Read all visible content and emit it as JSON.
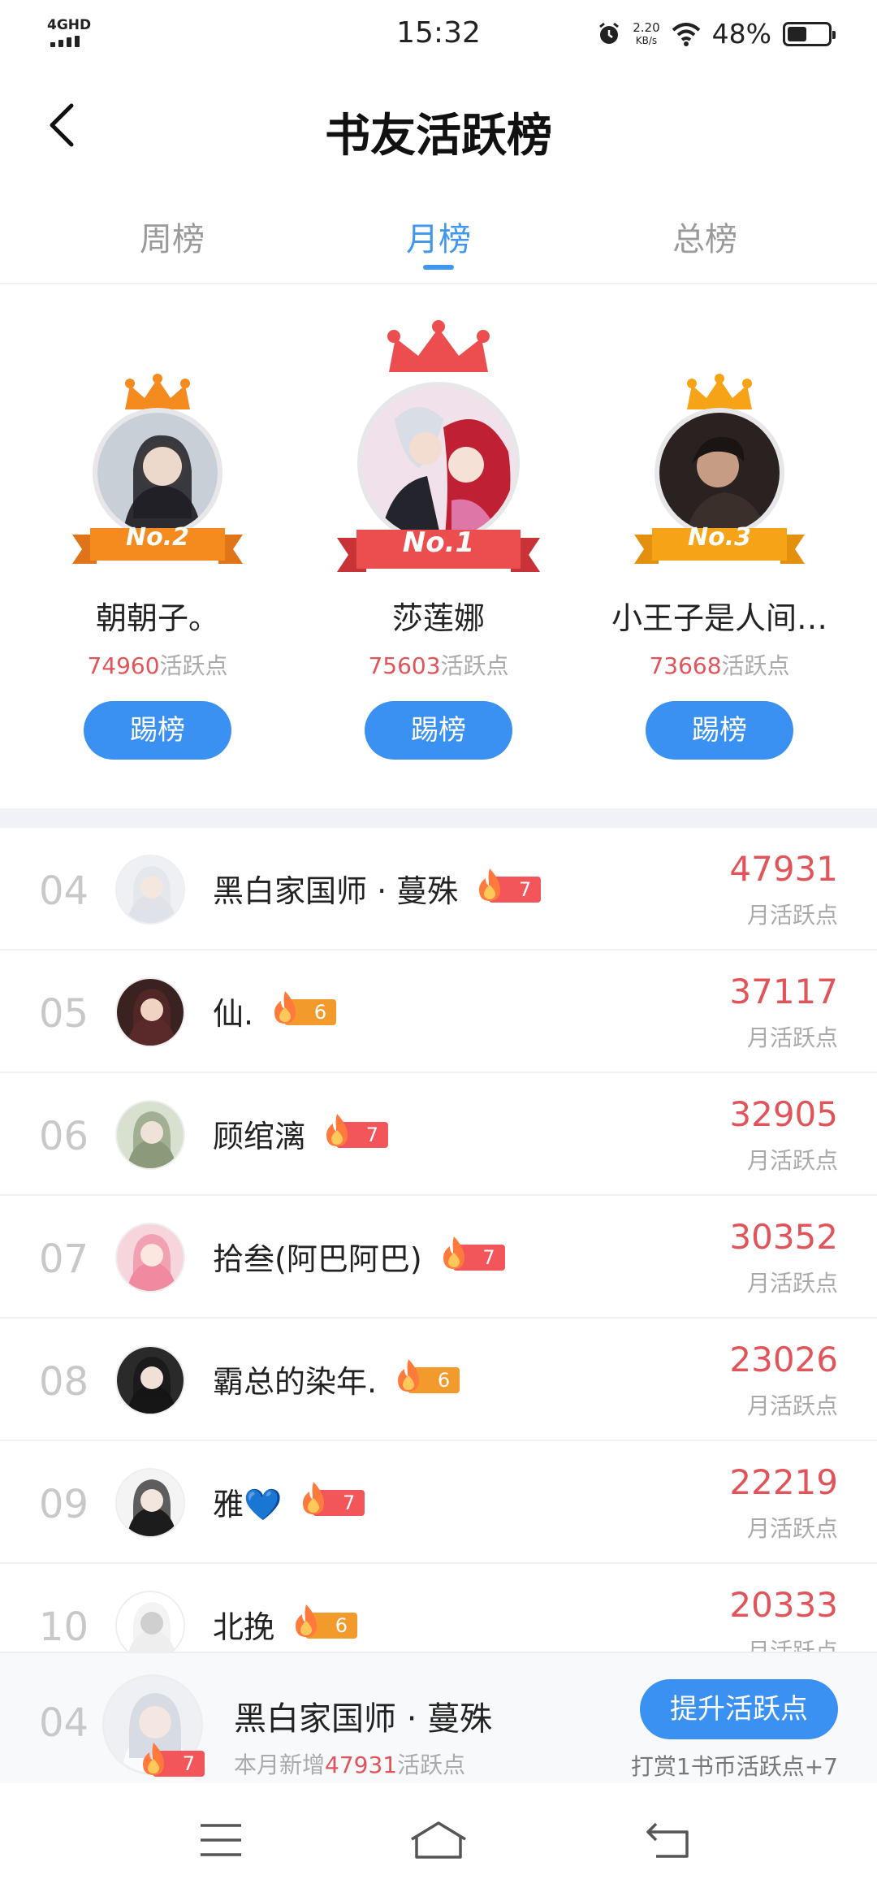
{
  "status_bar": {
    "network": "4GHD",
    "time": "15:32",
    "speed_value": "2.20",
    "speed_unit": "KB/s",
    "battery_text": "48%",
    "battery_level": 0.48
  },
  "nav": {
    "title": "书友活跃榜"
  },
  "tabs": [
    {
      "label": "周榜",
      "active": false
    },
    {
      "label": "月榜",
      "active": true
    },
    {
      "label": "总榜",
      "active": false
    }
  ],
  "podium": {
    "first": {
      "rank_label": "No.1",
      "name": "莎莲娜",
      "points": "75603",
      "points_suffix": "活跃点",
      "button": "踢榜"
    },
    "second": {
      "rank_label": "No.2",
      "name": "朝朝子。",
      "points": "74960",
      "points_suffix": "活跃点",
      "button": "踢榜"
    },
    "third": {
      "rank_label": "No.3",
      "name": "小王子是人间…",
      "points": "73668",
      "points_suffix": "活跃点",
      "button": "踢榜"
    }
  },
  "list": [
    {
      "rank": "04",
      "name": "黑白家国师 · 蔓殊",
      "level": "7",
      "score": "47931",
      "label": "月活跃点"
    },
    {
      "rank": "05",
      "name": "仙.",
      "level": "6",
      "score": "37117",
      "label": "月活跃点"
    },
    {
      "rank": "06",
      "name": "顾绾漓",
      "level": "7",
      "score": "32905",
      "label": "月活跃点"
    },
    {
      "rank": "07",
      "name": "拾叁(阿巴阿巴)",
      "level": "7",
      "score": "30352",
      "label": "月活跃点"
    },
    {
      "rank": "08",
      "name": "霸总的染年.",
      "level": "6",
      "score": "23026",
      "label": "月活跃点"
    },
    {
      "rank": "09",
      "name": "雅💙",
      "level": "7",
      "score": "22219",
      "label": "月活跃点"
    },
    {
      "rank": "10",
      "name": "北挽",
      "level": "6",
      "score": "20333",
      "label": "月活跃点"
    }
  ],
  "my_rank": {
    "rank": "04",
    "name": "黑白家国师 · 蔓殊",
    "level": "7",
    "sub_prefix": "本月新增",
    "sub_points": "47931",
    "sub_suffix": "活跃点",
    "button": "提升活跃点",
    "tip": "打赏1书币活跃点+7"
  },
  "colors": {
    "accent": "#3b91f2",
    "score": "#e0545a",
    "badge_level7": "#f2555a",
    "badge_level6": "#f39a2c",
    "crown_gold": "#f6a317",
    "crown_orange": "#f58a1f",
    "crown_red": "#ec4d4f"
  }
}
